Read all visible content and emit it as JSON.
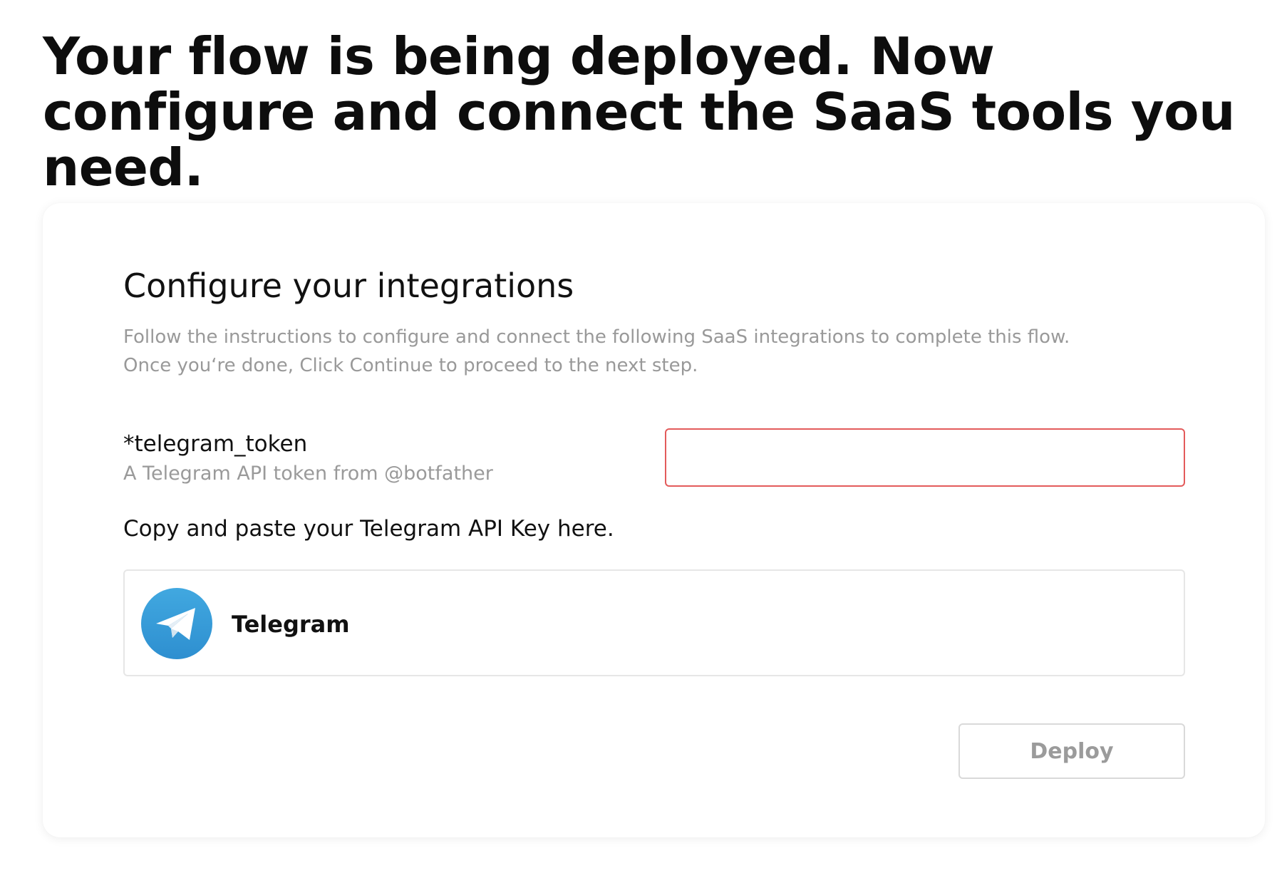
{
  "headline": "Your flow is being deployed. Now configure and connect the SaaS tools you need.",
  "card": {
    "title": "Configure your integrations",
    "description_line1": "Follow the instructions to configure and connect the following SaaS integrations to complete this flow.",
    "description_line2": "Once you‘re done, Click Continue to proceed to the next step."
  },
  "field": {
    "label": "*telegram_token",
    "hint": "A Telegram API token from @botfather",
    "value": "",
    "placeholder": "",
    "error_border_color": "#e35b5b"
  },
  "instruction": "Copy and paste your Telegram API Key here.",
  "integration": {
    "name": "Telegram",
    "icon": "telegram-icon",
    "brand_color": "#37a6de"
  },
  "actions": {
    "deploy_label": "Deploy",
    "deploy_enabled": false
  }
}
